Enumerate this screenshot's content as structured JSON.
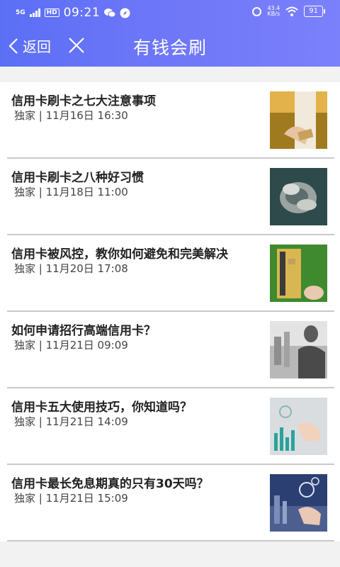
{
  "status_bar": {
    "network_type": "5G",
    "hd_badge": "HD",
    "time": "09:21",
    "speed_value": "43.4",
    "speed_unit": "KB/s",
    "battery": "91"
  },
  "nav": {
    "back_label": "返回",
    "title": "有钱会刷"
  },
  "articles": [
    {
      "title": "信用卡刷卡之七大注意事项",
      "source": "独家",
      "date": "11月16日 16:30",
      "thumb": "card-payment-image"
    },
    {
      "title": "信用卡刷卡之八种好习惯",
      "source": "独家",
      "date": "11月18日 11:00",
      "thumb": "globe-clouds-image"
    },
    {
      "title": "信用卡被风控，教你如何避免和完美解决",
      "source": "独家",
      "date": "11月20日 17:08",
      "thumb": "gold-card-image"
    },
    {
      "title": "如何申请招行高端信用卡？",
      "source": "独家",
      "date": "11月21日 09:09",
      "thumb": "business-city-image"
    },
    {
      "title": "信用卡五大使用技巧，你知道吗？",
      "source": "独家",
      "date": "11月21日 14:09",
      "thumb": "touch-chart-image"
    },
    {
      "title": "信用卡最长免息期真的只有30天吗？",
      "source": "独家",
      "date": "11月21日 15:09",
      "thumb": "finance-dollar-image"
    }
  ],
  "colors": {
    "header_start": "#5b6ff5",
    "header_end": "#7b80fb",
    "text_dark": "#222222",
    "divider": "#c9c9c9"
  }
}
